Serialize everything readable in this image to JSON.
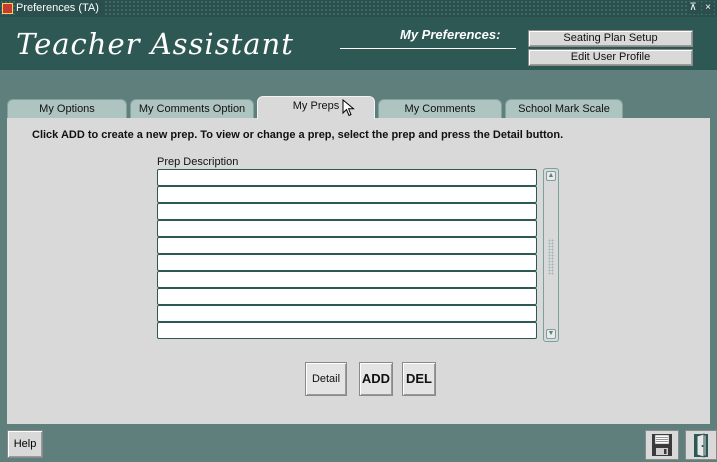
{
  "window": {
    "title": "Preferences (TA)",
    "restore_glyph": "⊼",
    "close_glyph": "×"
  },
  "header": {
    "app_name": "Teacher Assistant",
    "section_label": "My Preferences:",
    "seating_plan_label": "Seating Plan Setup",
    "edit_profile_label": "Edit User Profile"
  },
  "tabs": [
    {
      "label": "My Options",
      "active": false
    },
    {
      "label": "My Comments Option",
      "active": false
    },
    {
      "label": "My Preps",
      "active": true
    },
    {
      "label": "My Comments",
      "active": false
    },
    {
      "label": "School Mark Scale",
      "active": false
    }
  ],
  "main": {
    "instruction": "Click ADD to create a new prep. To view or change a prep, select the prep and press the Detail button.",
    "column_header": "Prep Description",
    "rows": [
      "",
      "",
      "",
      "",
      "",
      "",
      "",
      "",
      "",
      "",
      "",
      ""
    ],
    "scroll_up_glyph": "▲",
    "scroll_down_glyph": "▼",
    "detail_label": "Detail",
    "add_label": "ADD",
    "del_label": "DEL"
  },
  "footer": {
    "help_label": "Help",
    "save_icon": "floppy-disk-icon",
    "exit_icon": "exit-door-icon"
  },
  "colors": {
    "header_bg": "#2d5854",
    "background": "#5f7f7c",
    "panel_bg": "#d9d9d9",
    "inactive_tab": "#aec4c0"
  }
}
